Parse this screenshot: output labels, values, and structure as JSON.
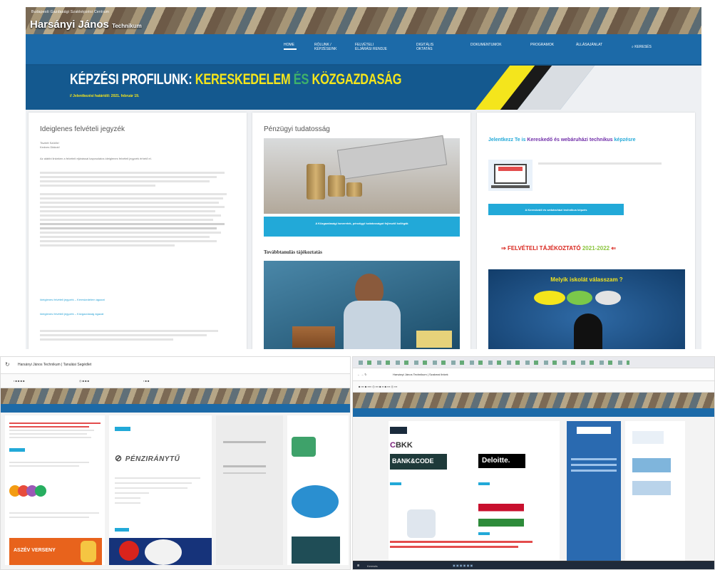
{
  "header": {
    "small_title": "Budapesti Gazdasági Szakképzési Centrum",
    "title": "Harsányi János",
    "title_suffix": "Technikum"
  },
  "nav": {
    "items": [
      {
        "label": "HOME"
      },
      {
        "label": "RÓLUNK / KÉPZÉSEINK"
      },
      {
        "label": "FELVÉTELI ELJÁRÁSI RENDJE"
      },
      {
        "label": "DIGITÁLIS OKTATÁS"
      },
      {
        "label": "DOKUMENTUMOK"
      },
      {
        "label": "PROGRAMOK"
      },
      {
        "label": "ÁLLÁSAJÁNLAT"
      }
    ],
    "search_label": "KERESÉS"
  },
  "banner": {
    "heading_part1": "KÉPZÉSI PROFILUNK:",
    "heading_part2": "KERESKEDELEM",
    "heading_part3": "ÉS",
    "heading_part4": "KÖZGAZDASÁG",
    "subline": "// Jelentkezési határidő: 2021. február 19."
  },
  "col1": {
    "title": "Ideiglenes felvételi jegyzék",
    "lines": [
      "Tisztelt Szülők!",
      "Kedves Diákok!"
    ],
    "body": "Az alábbi linkeken a felvételi eljárással kapcsolatos ideiglenes felvételi jegyzék érhető el.",
    "link1": "Ideiglenes felvételi jegyzék – Kereskedelem ágazat",
    "link2": "Ideiglenes felvételi jegyzék – Közgazdaság ágazat"
  },
  "col2": {
    "title": "Pénzügyi tudatosság",
    "button": "A Közgazdasági ismeretek, pénzügyi tudatosságot fejlesztő kollégák",
    "subtitle": "Továbbtanulás tájékoztatás"
  },
  "col3": {
    "title_part1": "Jelentkezz Te is",
    "title_part2": "Kereskedő és webáruházi technikus",
    "title_part3": "képzésre",
    "button": "A Kereskedő és webáruházi technikus képzés",
    "admission": "FELVÉTELI TÁJÉKOZTATÓ",
    "years": "2021-2022",
    "quiz": "Melyik iskolát válasszam ?"
  },
  "left_browser": {
    "tab_title": "Harsányi János Technikum | Tanulási Segédlet",
    "pen_title": "PÉNZIRÁNYTŰ",
    "prefix": "PÉNZ",
    "suffix": "IRÁNYTŰ",
    "contest": "ASZÉV VERSENY"
  },
  "right_browser": {
    "tab_title": "Harsányi János Technikum | Szakmai linkek",
    "bkk": "BKK",
    "bank": "BANK&CODE",
    "deloitte": "Deloitte.",
    "taskbar_label": "Keresés"
  },
  "colors": {
    "nav": "#1c6aa8",
    "accent_yellow": "#f4e51c",
    "accent_green": "#3fb06a",
    "cyan": "#22a9d8",
    "purple": "#6f2da8",
    "red": "#d9241c"
  }
}
